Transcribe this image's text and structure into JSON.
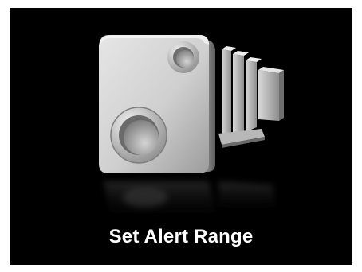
{
  "tile": {
    "label": "Set Alert Range",
    "icon": "security-camera-icon",
    "background_color": "#000000",
    "label_color": "#ffffff"
  }
}
